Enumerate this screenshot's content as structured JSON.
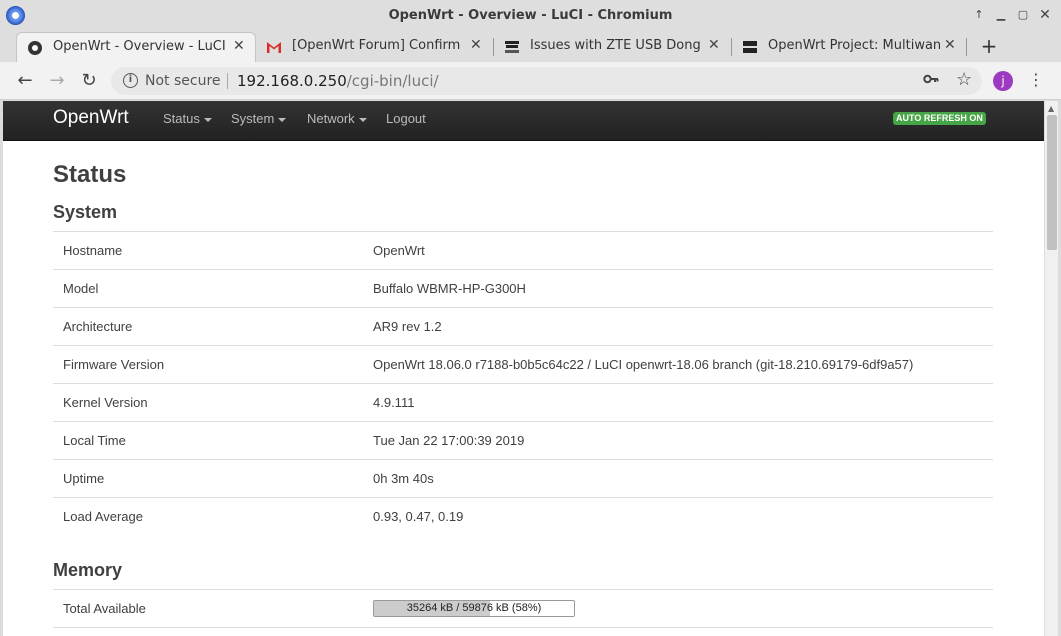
{
  "window": {
    "title": "OpenWrt - Overview - LuCI - Chromium"
  },
  "tabs": [
    {
      "label": "OpenWrt - Overview - LuCI",
      "icon": "openwrt-icon",
      "active": true
    },
    {
      "label": "[OpenWrt Forum] Confirm",
      "icon": "gmail-icon",
      "active": false
    },
    {
      "label": "Issues with ZTE USB Dong",
      "icon": "openwrt-forum-icon",
      "active": false
    },
    {
      "label": "OpenWrt Project: Multiwan",
      "icon": "openwrt-wiki-icon",
      "active": false
    }
  ],
  "omnibox": {
    "security": "Not secure",
    "host": "192.168.0.250",
    "path": "/cgi-bin/luci/"
  },
  "profile": {
    "initial": "j",
    "color": "#9c3bc0"
  },
  "luci": {
    "brand": "OpenWrt",
    "menu": [
      "Status",
      "System",
      "Network",
      "Logout"
    ],
    "autorefresh": "AUTO REFRESH ON"
  },
  "page": {
    "title": "Status",
    "system": {
      "heading": "System",
      "rows": [
        {
          "label": "Hostname",
          "value": "OpenWrt"
        },
        {
          "label": "Model",
          "value": "Buffalo WBMR-HP-G300H"
        },
        {
          "label": "Architecture",
          "value": "AR9 rev 1.2"
        },
        {
          "label": "Firmware Version",
          "value": "OpenWrt 18.06.0 r7188-b0b5c64c22 / LuCI openwrt-18.06 branch (git-18.210.69179-6df9a57)"
        },
        {
          "label": "Kernel Version",
          "value": "4.9.111"
        },
        {
          "label": "Local Time",
          "value": "Tue Jan 22 17:00:39 2019"
        },
        {
          "label": "Uptime",
          "value": "0h 3m 40s"
        },
        {
          "label": "Load Average",
          "value": "0.93, 0.47, 0.19"
        }
      ]
    },
    "memory": {
      "heading": "Memory",
      "rows": [
        {
          "label": "Total Available",
          "value": "35264 kB / 59876 kB (58%)",
          "percent": 58
        }
      ]
    }
  },
  "colors": {
    "navbar": "#222222",
    "autorefresh_badge": "#46a546"
  }
}
